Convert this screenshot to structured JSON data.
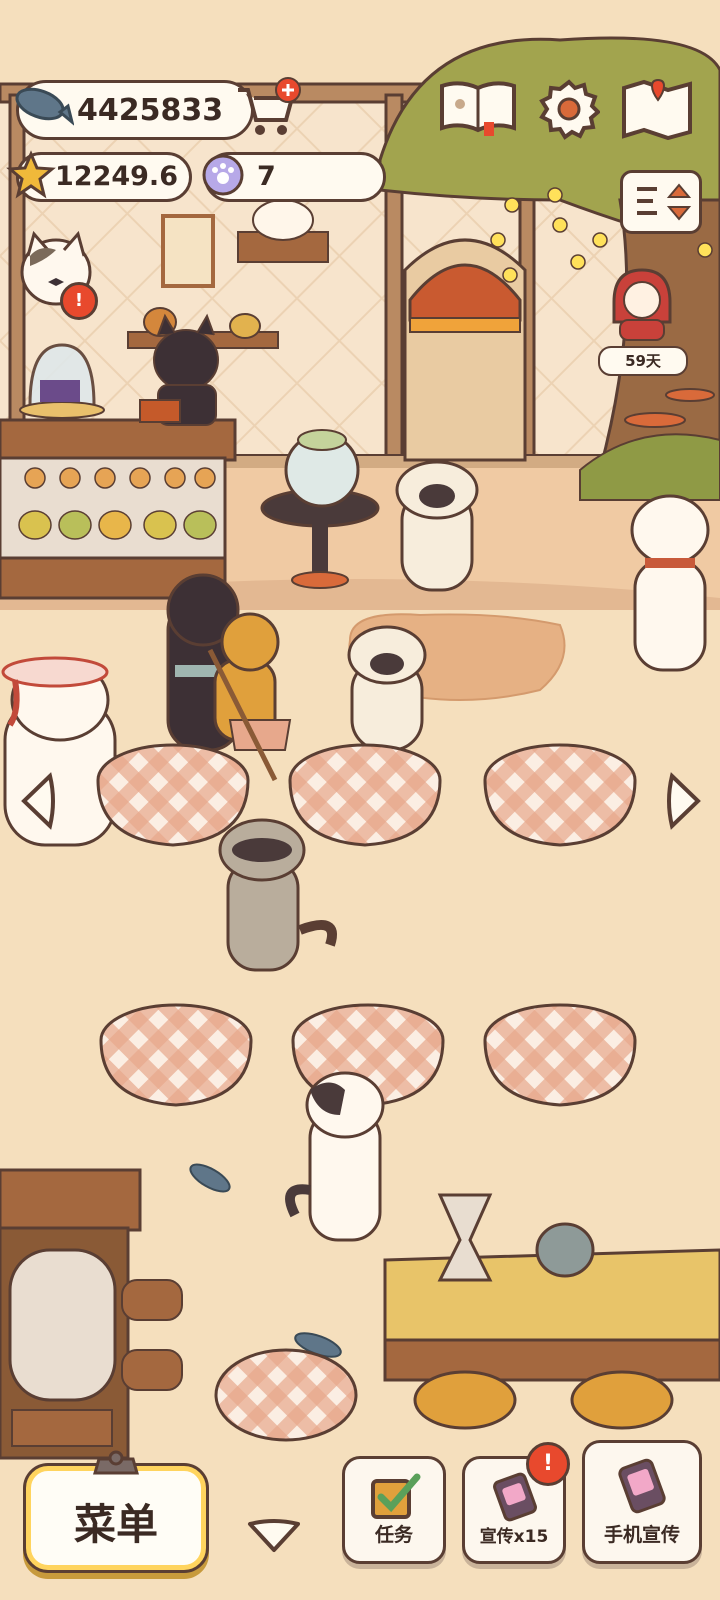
{
  "currency": {
    "fish": "4425833",
    "stars": "12249.6",
    "paw_tokens": "7"
  },
  "event": {
    "days_left": "59天"
  },
  "bottom_bar": {
    "menu_label": "菜单",
    "tasks_label": "任务",
    "promote_label": "宣传x15",
    "phone_promote_label": "手机宣传"
  },
  "icons": {
    "fish": "fish-icon",
    "cart_add": "shop-cart-add-icon",
    "star": "star-icon",
    "paw": "paw-coin-icon",
    "book": "recipe-book-icon",
    "gear": "settings-gear-icon",
    "map": "map-icon",
    "sort": "sort-arrows-icon",
    "arrow_left": "scroll-left-arrow-icon",
    "arrow_right": "scroll-right-arrow-icon",
    "arrow_down": "collapse-down-arrow-icon",
    "checkbox": "task-checkbox-icon",
    "promo_card": "promo-card-icon",
    "phone_card": "phone-card-icon",
    "alert": "alert-badge-icon"
  },
  "colors": {
    "background": "#f5dfbd",
    "outline": "#5a3e33",
    "accent_yellow": "#ffd45e",
    "alert_red": "#e8492d",
    "checker": "#d98c6c"
  }
}
